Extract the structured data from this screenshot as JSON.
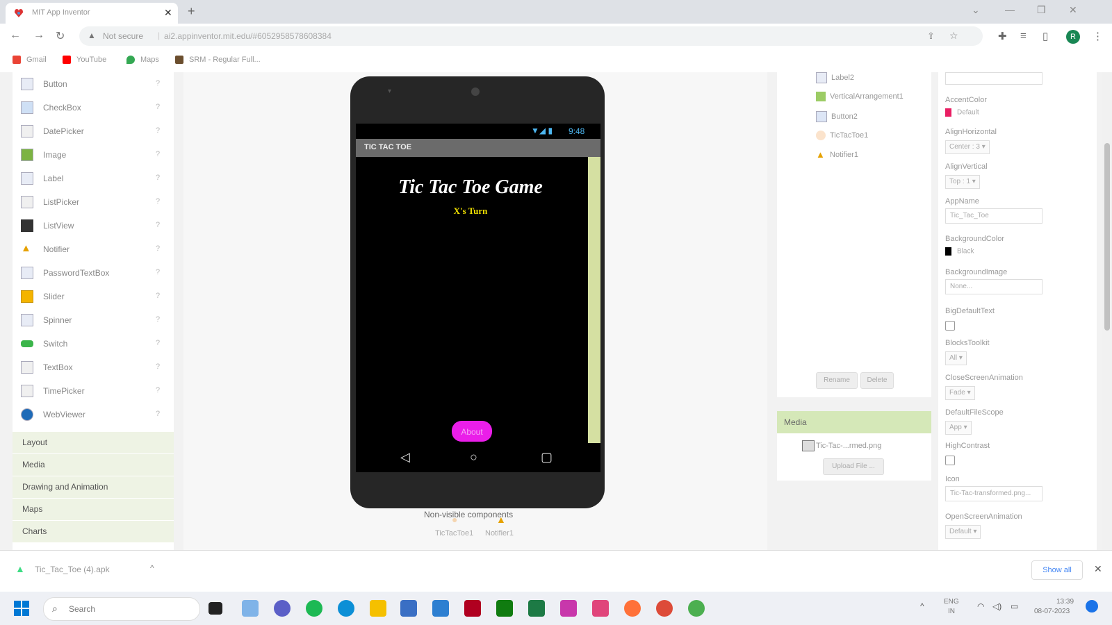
{
  "browser": {
    "tab_title": "MIT App Inventor",
    "tab_close": "✕",
    "new_tab": "+",
    "not_secure": "Not secure",
    "url": "ai2.appinventor.mit.edu/#6052958578608384",
    "bookmarks": [
      {
        "label": "Gmail",
        "color": "#ea4335"
      },
      {
        "label": "YouTube",
        "color": "#ff0000"
      },
      {
        "label": "Maps",
        "color": "#34a853"
      },
      {
        "label": "SRM - Regular Full...",
        "color": "#6b4e2e"
      }
    ],
    "profile_initial": "R"
  },
  "palette": {
    "items": [
      {
        "label": "Button",
        "icon": "button-icon"
      },
      {
        "label": "CheckBox",
        "icon": "checkbox-icon"
      },
      {
        "label": "DatePicker",
        "icon": "datepicker-icon"
      },
      {
        "label": "Image",
        "icon": "image-icon"
      },
      {
        "label": "Label",
        "icon": "label-icon"
      },
      {
        "label": "ListPicker",
        "icon": "listpicker-icon"
      },
      {
        "label": "ListView",
        "icon": "listview-icon"
      },
      {
        "label": "Notifier",
        "icon": "notifier-icon"
      },
      {
        "label": "PasswordTextBox",
        "icon": "password-icon"
      },
      {
        "label": "Slider",
        "icon": "slider-icon"
      },
      {
        "label": "Spinner",
        "icon": "spinner-icon"
      },
      {
        "label": "Switch",
        "icon": "switch-icon"
      },
      {
        "label": "TextBox",
        "icon": "textbox-icon"
      },
      {
        "label": "TimePicker",
        "icon": "timepicker-icon"
      },
      {
        "label": "WebViewer",
        "icon": "webviewer-icon"
      }
    ],
    "help": "?",
    "categories": [
      "Layout",
      "Media",
      "Drawing and Animation",
      "Maps",
      "Charts"
    ]
  },
  "phone": {
    "time": "9:48",
    "screen_title": "TIC TAC TOE",
    "game_title": "Tic Tac Toe Game",
    "turn_label": "X's Turn",
    "about_button": "About"
  },
  "nonvisible": {
    "label": "Non-visible components",
    "items": [
      "TicTacToe1",
      "Notifier1"
    ]
  },
  "components": {
    "tree": [
      "Label2",
      "VerticalArrangement1",
      "Button2",
      "TicTacToe1",
      "Notifier1"
    ],
    "rename": "Rename",
    "delete": "Delete"
  },
  "media": {
    "title": "Media",
    "file": "Tic-Tac-...rmed.png",
    "upload": "Upload File ..."
  },
  "properties": {
    "accent_label": "AccentColor",
    "accent_value": "Default",
    "alignh_label": "AlignHorizontal",
    "alignh_value": "Center : 3 ▾",
    "alignv_label": "AlignVertical",
    "alignv_value": "Top : 1 ▾",
    "appname_label": "AppName",
    "appname_value": "Tic_Tac_Toe",
    "bgcolor_label": "BackgroundColor",
    "bgcolor_value": "Black",
    "bgimage_label": "BackgroundImage",
    "bgimage_value": "None...",
    "bigtext_label": "BigDefaultText",
    "toolkit_label": "BlocksToolkit",
    "toolkit_value": "All ▾",
    "closeanim_label": "CloseScreenAnimation",
    "closeanim_value": "Fade ▾",
    "filescope_label": "DefaultFileScope",
    "filescope_value": "App ▾",
    "highcontrast_label": "HighContrast",
    "icon_label": "Icon",
    "icon_value": "Tic-Tac-transformed.png...",
    "openanim_label": "OpenScreenAnimation",
    "openanim_value": "Default ▾"
  },
  "download": {
    "file": "Tic_Tac_Toe (4).apk",
    "show_all": "Show all"
  },
  "taskbar": {
    "search": "Search",
    "lang": "ENG",
    "region": "IN",
    "time": "13:39",
    "date": "08-07-2023"
  },
  "colors": {
    "accent_swatch": "#e91e63",
    "category_bg": "#eef3e4",
    "about_button": "#ea1ee9",
    "scrollbar": "#d5e0a2"
  }
}
